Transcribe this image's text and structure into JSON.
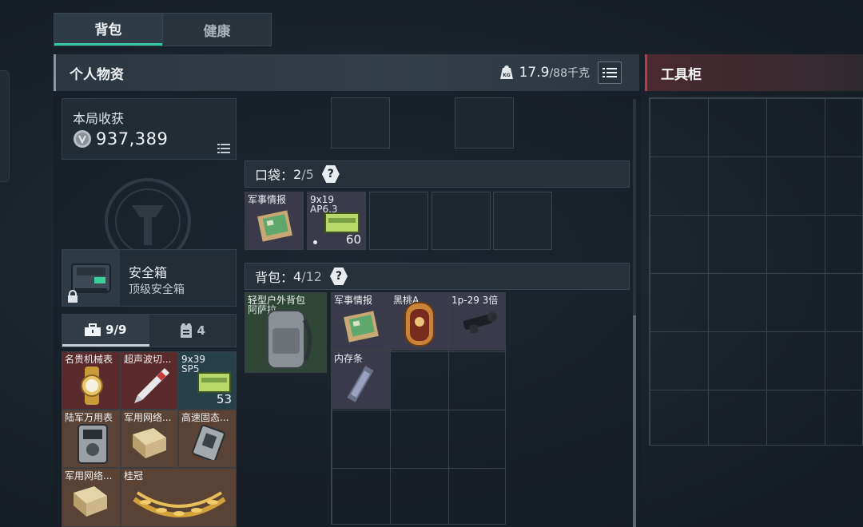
{
  "tabs": [
    {
      "label": "背包",
      "active": true
    },
    {
      "label": "健康",
      "active": false
    }
  ],
  "personal": {
    "title": "个人物资",
    "weight_current": "17.9",
    "weight_max": "/88千克",
    "weight_icon": "kg-weight-icon"
  },
  "locker": {
    "title": "工具柜"
  },
  "income": {
    "label": "本局收获",
    "value": "937,389"
  },
  "safe_box": {
    "name": "安全箱",
    "subtitle": "顶级安全箱"
  },
  "container_tabs": [
    {
      "label": "9/9",
      "icon": "toolbox-icon",
      "active": true
    },
    {
      "label": "4",
      "icon": "vest-icon",
      "active": false
    }
  ],
  "safe_items": [
    {
      "name": "名贵机械表",
      "rarity": "red"
    },
    {
      "name": "超声波切...",
      "rarity": "red"
    },
    {
      "name": "9x39",
      "name2": "SP5",
      "count": "53",
      "rarity": "teal"
    },
    {
      "name": "陆军万用表",
      "rarity": "brown"
    },
    {
      "name": "军用网络...",
      "rarity": "brown"
    },
    {
      "name": "高速固态...",
      "rarity": "brown"
    },
    {
      "name": "军用网络...",
      "rarity": "brown"
    },
    {
      "name": "桂冠",
      "rarity": "brown"
    }
  ],
  "pocket": {
    "label": "口袋：",
    "used": "2",
    "capacity": "/5",
    "help": "?",
    "items": [
      {
        "name": "军事情报",
        "rarity": "purple"
      },
      {
        "name": "9x19",
        "name2": "AP6.3",
        "count": "60",
        "rarity": "purple"
      }
    ]
  },
  "backpack": {
    "label": "背包：",
    "used": "4",
    "capacity": "/12",
    "help": "?",
    "equipped": {
      "name": "轻型户外背包",
      "name2": "阿萨拉",
      "rarity": "green"
    },
    "items": [
      {
        "name": "军事情报",
        "rarity": "purple"
      },
      {
        "name": "黑桃A",
        "rarity": "purple"
      },
      {
        "name": "1p-29 3倍",
        "rarity": "purple"
      },
      {
        "name": "内存条",
        "rarity": "purple"
      }
    ]
  },
  "colors": {
    "accent_tab": "#34c7a2",
    "rarity_red": "#5a2a2c",
    "rarity_brown": "#5a4335",
    "rarity_purple": "#3a3a4a",
    "rarity_teal": "#27414a",
    "rarity_green": "#2f4536",
    "locker_accent": "#b83a44"
  }
}
